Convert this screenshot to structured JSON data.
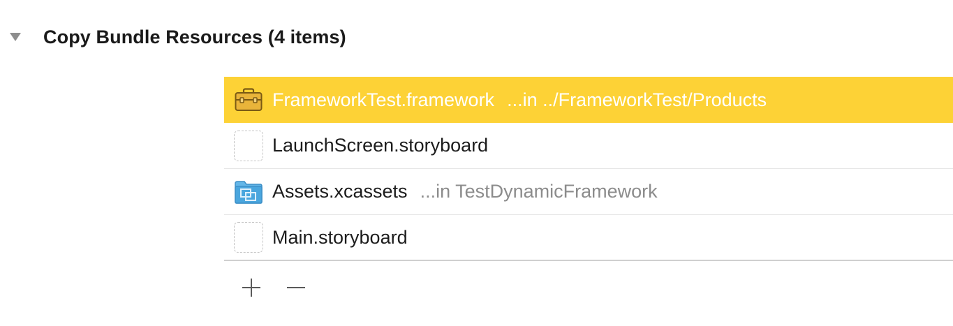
{
  "section": {
    "title": "Copy Bundle Resources (4 items)",
    "expanded": true
  },
  "files": [
    {
      "name": "FrameworkTest.framework",
      "location": "...in ../FrameworkTest/Products",
      "icon": "framework-toolbox-icon",
      "selected": true
    },
    {
      "name": "LaunchScreen.storyboard",
      "location": "",
      "icon": "storyboard-placeholder-icon",
      "selected": false
    },
    {
      "name": "Assets.xcassets",
      "location": "...in TestDynamicFramework",
      "icon": "asset-catalog-folder-icon",
      "selected": false
    },
    {
      "name": "Main.storyboard",
      "location": "",
      "icon": "storyboard-placeholder-icon",
      "selected": false
    }
  ],
  "toolbar": {
    "add_icon": "plus-icon",
    "remove_icon": "minus-icon"
  },
  "colors": {
    "selection": "#fdd236",
    "secondary_text": "#8c8c8c",
    "folder_blue": "#4aa6de"
  }
}
